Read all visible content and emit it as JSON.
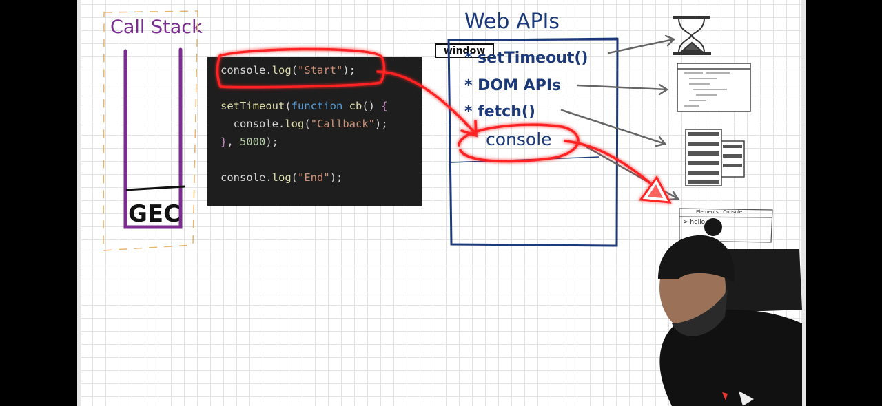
{
  "call_stack": {
    "title": "Call Stack",
    "frame_label": "GEC"
  },
  "code": {
    "lines": [
      [
        [
          "console",
          "txt"
        ],
        [
          ".",
          "txt"
        ],
        [
          "log",
          "fn"
        ],
        [
          "(",
          "txt"
        ],
        [
          "\"Start\"",
          "str"
        ],
        [
          ");",
          "txt"
        ]
      ],
      [],
      [
        [
          "setTimeout",
          "fn"
        ],
        [
          "(",
          "txt"
        ],
        [
          "function",
          "kw"
        ],
        [
          " ",
          "txt"
        ],
        [
          "cb",
          "fn"
        ],
        [
          "() ",
          "txt"
        ],
        [
          "{",
          "br"
        ]
      ],
      [
        [
          "  console",
          "txt"
        ],
        [
          ".",
          "txt"
        ],
        [
          "log",
          "fn"
        ],
        [
          "(",
          "txt"
        ],
        [
          "\"Callback\"",
          "str"
        ],
        [
          ");",
          "txt"
        ]
      ],
      [
        [
          "}",
          "br"
        ],
        [
          ", ",
          "txt"
        ],
        [
          "5000",
          "num"
        ],
        [
          ");",
          "txt"
        ]
      ],
      [],
      [
        [
          "console",
          "txt"
        ],
        [
          ".",
          "txt"
        ],
        [
          "log",
          "fn"
        ],
        [
          "(",
          "txt"
        ],
        [
          "\"End\"",
          "str"
        ],
        [
          ");",
          "txt"
        ]
      ]
    ]
  },
  "web_apis": {
    "title": "Web APIs",
    "window_label": "window",
    "items": [
      "* setTimeout()",
      "* DOM APIs",
      "* fetch()",
      "console"
    ]
  },
  "devtools_sketch": {
    "tabs": "Elements   Console",
    "prompt": "> hello"
  },
  "colors": {
    "stack_purple": "#7a2d8f",
    "stack_dashed_orange": "#e8b56a",
    "webapi_blue": "#1c3a7a",
    "highlight_red": "#ff2020",
    "code_bg": "#1e1e1e"
  },
  "icons": [
    "hourglass-icon",
    "html-document-icon",
    "server-stack-icon",
    "chrome-devtools-icon",
    "presenter-avatar"
  ]
}
